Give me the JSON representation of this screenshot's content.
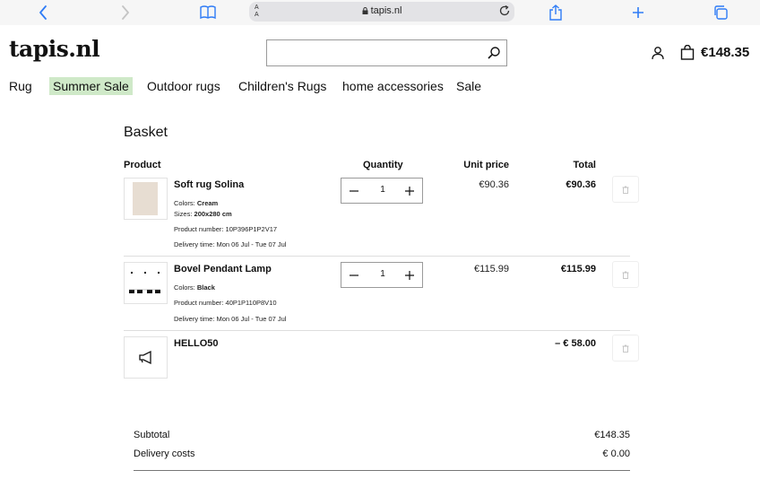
{
  "browser": {
    "aa_label": "A A",
    "url": "tapis.nl"
  },
  "site": {
    "logo": "tapis.nl",
    "search_placeholder": "",
    "cart_total": "€148.35"
  },
  "nav": [
    {
      "label": "Rug"
    },
    {
      "label": "Summer Sale"
    },
    {
      "label": "Outdoor rugs"
    },
    {
      "label": "Children's Rugs"
    },
    {
      "label": "home accessories"
    },
    {
      "label": "Sale"
    }
  ],
  "basket": {
    "title": "Basket",
    "headers": {
      "product": "Product",
      "quantity": "Quantity",
      "unit_price": "Unit price",
      "total": "Total"
    },
    "items": [
      {
        "name": "Soft rug Solina",
        "colors_label": "Colors:",
        "colors_value": "Cream",
        "sizes_label": "Sizes:",
        "sizes_value": "200x280 cm",
        "product_number": "Product number: 10P396P1P2V17",
        "delivery": "Delivery time: Mon 06 Jul - Tue 07 Jul",
        "quantity": "1",
        "unit_price": "€90.36",
        "total": "€90.36"
      },
      {
        "name": "Bovel Pendant Lamp",
        "colors_label": "Colors:",
        "colors_value": "Black",
        "product_number": "Product number: 40P1P110P8V10",
        "delivery": "Delivery time: Mon 06 Jul - Tue 07 Jul",
        "quantity": "1",
        "unit_price": "€115.99",
        "total": "€115.99"
      }
    ],
    "coupon": {
      "code": "HELLO50",
      "total": "– € 58.00"
    },
    "summary": {
      "subtotal_label": "Subtotal",
      "subtotal_value": "€148.35",
      "delivery_label": "Delivery costs",
      "delivery_value": "€ 0.00"
    }
  },
  "colors": {
    "accent_highlight": "#cfe9c8",
    "browser_blue": "#2f7cf6"
  }
}
